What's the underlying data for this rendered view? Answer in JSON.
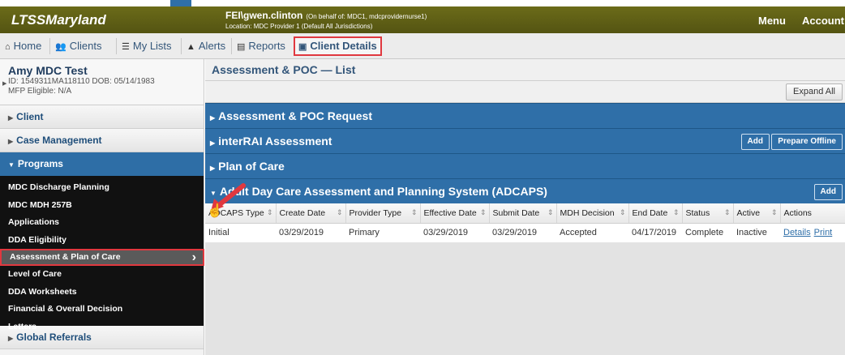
{
  "header": {
    "brand": "LTSSMaryland",
    "user": "FEI\\gwen.clinton",
    "on_behalf": "(On behalf of: MDC1, mdcprovidernurse1)",
    "location": "Location: MDC Provider 1 (Default All Jurisdictions)",
    "menu": "Menu",
    "account": "Account"
  },
  "nav": {
    "home": "Home",
    "clients": "Clients",
    "my_lists": "My Lists",
    "alerts": "Alerts",
    "reports": "Reports",
    "client_details": "Client Details"
  },
  "client": {
    "name": "Amy MDC Test",
    "id_dob": "ID: 1549311MA118110 DOB: 05/14/1983",
    "mfp": "MFP Eligible: N/A"
  },
  "sidebar": {
    "client": "Client",
    "case_management": "Case Management",
    "programs": "Programs",
    "program_items": [
      "MDC Discharge Planning",
      "MDC MDH 257B",
      "Applications",
      "DDA Eligibility",
      "Assessment & Plan of Care",
      "Level of Care",
      "DDA Worksheets",
      "Financial & Overall Decision",
      "Letters"
    ],
    "global_referrals": "Global Referrals"
  },
  "main": {
    "title": "Assessment & POC — List",
    "expand_all": "Expand All",
    "panels": {
      "request": "Assessment & POC Request",
      "interrai": "interRAI Assessment",
      "poc": "Plan of Care",
      "adcaps": "Adult Day Care Assessment and Planning System (ADCAPS)"
    },
    "add": "Add",
    "prepare_offline": "Prepare Offline",
    "table": {
      "headers": [
        "ADCAPS Type",
        "Create Date",
        "Provider Type",
        "Effective Date",
        "Submit Date",
        "MDH Decision",
        "End Date",
        "Status",
        "Active",
        "Actions"
      ],
      "row": [
        "Initial",
        "03/29/2019",
        "Primary",
        "03/29/2019",
        "03/29/2019",
        "Accepted",
        "04/17/2019",
        "Complete",
        "Inactive"
      ],
      "details": "Details",
      "print": "Print"
    }
  },
  "colors": {
    "header": "#5f5f16",
    "panel_blue": "#2f6fa8",
    "highlight_red": "#e0383f"
  }
}
